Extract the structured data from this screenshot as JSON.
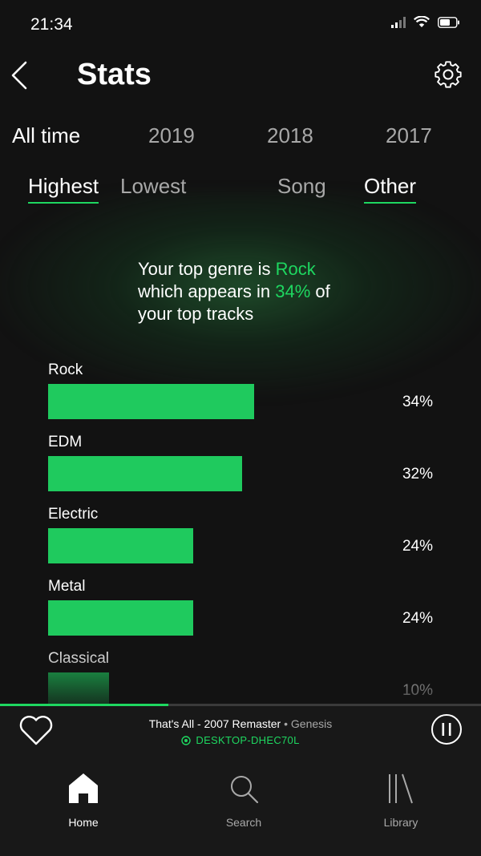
{
  "status_bar": {
    "time": "21:34"
  },
  "header": {
    "title": "Stats"
  },
  "periods": [
    {
      "label": "All time",
      "active": true
    },
    {
      "label": "2019",
      "active": false
    },
    {
      "label": "2018",
      "active": false
    },
    {
      "label": "2017",
      "active": false
    }
  ],
  "sort_tabs": [
    {
      "label": "Highest",
      "active": true
    },
    {
      "label": "Lowest",
      "active": false
    }
  ],
  "type_tabs": [
    {
      "label": "Song",
      "active": false
    },
    {
      "label": "Other",
      "active": true
    }
  ],
  "summary": {
    "line1_prefix": "Your top genre is ",
    "top_genre": "Rock",
    "line2_prefix": "which appears in ",
    "percent": "34%",
    "line2_suffix": " of",
    "line3": "your top tracks"
  },
  "chart_data": {
    "type": "bar",
    "orientation": "horizontal",
    "categories": [
      "Rock",
      "EDM",
      "Electric",
      "Metal",
      "Classical"
    ],
    "values": [
      34,
      32,
      24,
      24,
      10
    ],
    "value_labels": [
      "34%",
      "32%",
      "24%",
      "24%",
      "10%"
    ],
    "bar_color": "#1fca5e"
  },
  "now_playing": {
    "title": "That's All - 2007 Remaster",
    "separator": " • ",
    "artist": "Genesis",
    "device": "DESKTOP-DHEC70L",
    "progress": 0.35
  },
  "nav": [
    {
      "label": "Home",
      "icon": "home-icon",
      "active": true
    },
    {
      "label": "Search",
      "icon": "search-icon",
      "active": false
    },
    {
      "label": "Library",
      "icon": "library-icon",
      "active": false
    }
  ],
  "colors": {
    "accent": "#1ed760",
    "background": "#121212",
    "muted_text": "#a8a8a8"
  }
}
